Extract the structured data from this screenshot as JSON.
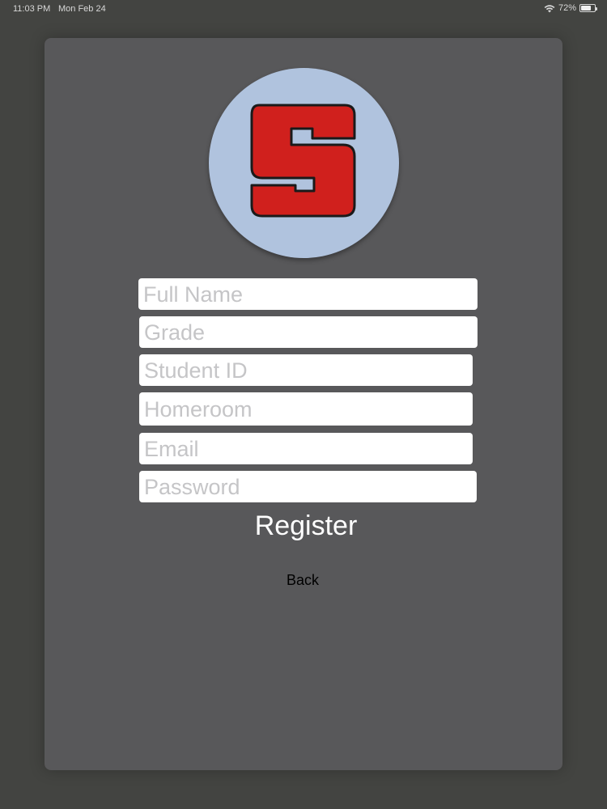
{
  "status_bar": {
    "time": "11:03 PM",
    "date": "Mon Feb 24",
    "battery_percent": "72%",
    "battery_level": 0.72,
    "wifi_icon": "wifi-icon",
    "battery_icon": "battery-icon"
  },
  "logo": {
    "letter": "S",
    "background_color": "#b0c3de",
    "letter_color": "#d0201d"
  },
  "form": {
    "full_name": {
      "placeholder": "Full Name",
      "value": ""
    },
    "grade": {
      "placeholder": "Grade",
      "value": ""
    },
    "student_id": {
      "placeholder": "Student ID",
      "value": ""
    },
    "homeroom": {
      "placeholder": "Homeroom",
      "value": ""
    },
    "email": {
      "placeholder": "Email",
      "value": ""
    },
    "password": {
      "placeholder": "Password",
      "value": ""
    }
  },
  "actions": {
    "register_label": "Register",
    "back_label": "Back"
  },
  "colors": {
    "background": "#434441",
    "panel": "#58585a"
  }
}
